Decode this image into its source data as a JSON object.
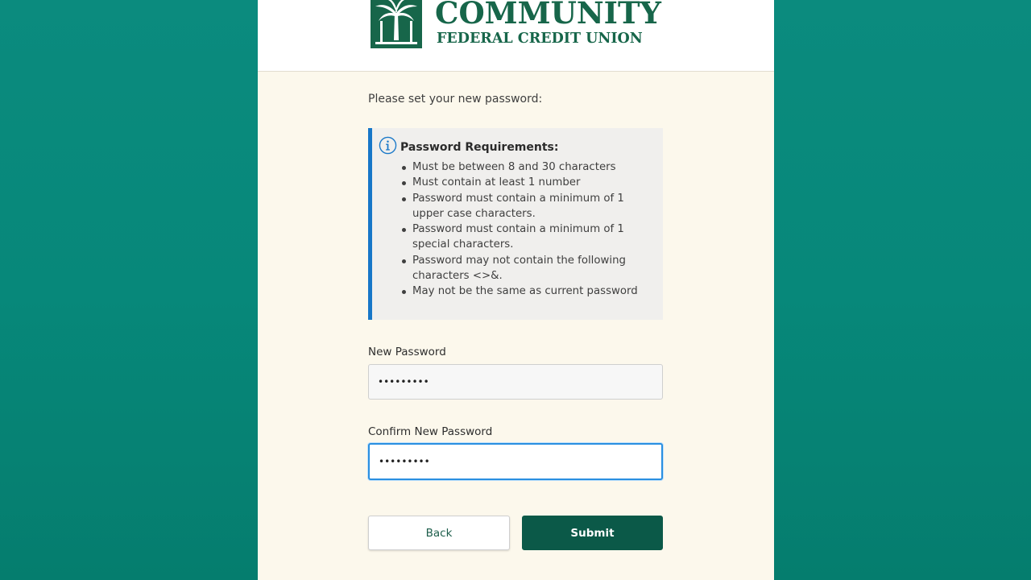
{
  "brand": {
    "name_line1": "COMMUNITY",
    "name_line2": "FEDERAL CREDIT UNION",
    "color": "#17664a",
    "logo_icon": "palm-tree-logo-icon"
  },
  "form": {
    "intro": "Please set your new password:",
    "requirements": {
      "icon": "info-icon",
      "title": "Password Requirements:",
      "accent_color": "#1777c8",
      "items": [
        "Must be between 8 and 30 characters",
        "Must contain at least 1 number",
        "Password must contain a minimum of 1 upper case characters.",
        "Password must contain a minimum of 1 special characters.",
        "Password may not contain the following characters <>&.",
        "May not be the same as current password"
      ]
    },
    "new_password": {
      "label": "New Password",
      "value": "•••••••••"
    },
    "confirm_password": {
      "label": "Confirm New Password",
      "value": "•••••••••"
    },
    "buttons": {
      "back": "Back",
      "submit": "Submit",
      "submit_color": "#0b5948"
    }
  }
}
